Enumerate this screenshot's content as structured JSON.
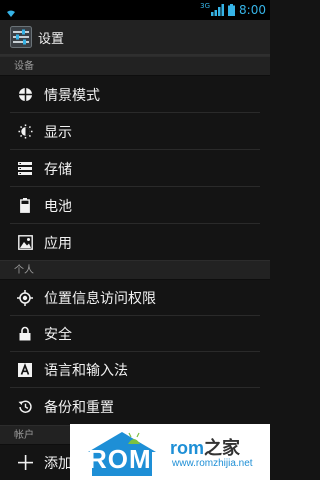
{
  "status_bar": {
    "time": "8:00",
    "network": "3G"
  },
  "action_bar": {
    "title": "设置"
  },
  "sections": {
    "device": "设备",
    "personal": "个人",
    "accounts": "帐户"
  },
  "device_items": [
    {
      "label": "情景模式",
      "icon": "profile-icon"
    },
    {
      "label": "显示",
      "icon": "display-icon"
    },
    {
      "label": "存储",
      "icon": "storage-icon"
    },
    {
      "label": "电池",
      "icon": "battery-icon"
    },
    {
      "label": "应用",
      "icon": "apps-icon"
    }
  ],
  "personal_items": [
    {
      "label": "位置信息访问权限",
      "icon": "location-icon"
    },
    {
      "label": "安全",
      "icon": "lock-icon"
    },
    {
      "label": "语言和输入法",
      "icon": "keyboard-icon"
    },
    {
      "label": "备份和重置",
      "icon": "backup-icon"
    }
  ],
  "account_items": [
    {
      "label": "添加",
      "icon": "add-icon"
    }
  ],
  "watermark": {
    "rom": "ROM",
    "zhijia": "之家",
    "url": "www.romzhijia.net"
  },
  "colors": {
    "accent": "#36b3e6",
    "background": "#141414"
  }
}
